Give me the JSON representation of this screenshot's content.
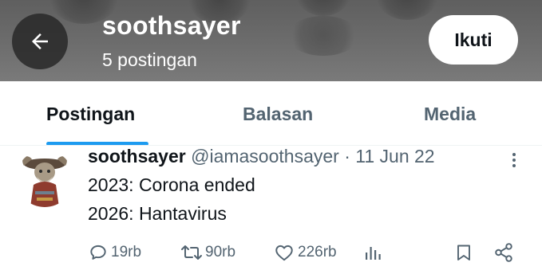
{
  "header": {
    "title": "soothsayer",
    "subtitle": "5 postingan",
    "follow_label": "Ikuti"
  },
  "tabs": [
    {
      "label": "Postingan"
    },
    {
      "label": "Balasan"
    },
    {
      "label": "Media"
    }
  ],
  "post": {
    "display_name": "soothsayer",
    "meta": "@iamasoothsayer · 11 Jun 22",
    "lines": [
      "2023: Corona ended",
      "2026: Hantavirus"
    ],
    "stats": {
      "replies": "19rb",
      "reposts": "90rb",
      "likes": "226rb"
    }
  },
  "colors": {
    "accent": "#1d9bf0",
    "secondary_text": "#536471",
    "header_bg": "#6b6b6b"
  },
  "icons": [
    "back-arrow-icon",
    "more-vertical-icon",
    "reply-icon",
    "repost-icon",
    "like-icon",
    "views-icon",
    "bookmark-icon",
    "share-icon"
  ]
}
